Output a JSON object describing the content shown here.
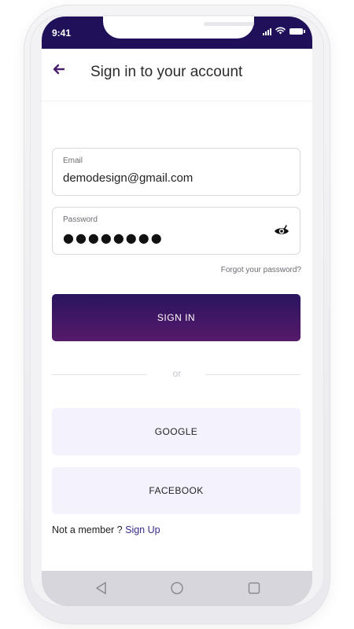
{
  "status_bar": {
    "time": "9:41",
    "icons": [
      "signal-icon",
      "wifi-icon",
      "battery-icon"
    ]
  },
  "header": {
    "back_icon": "arrow-left-icon",
    "title": "Sign in to your account"
  },
  "form": {
    "email": {
      "label": "Email",
      "value": "demodesign@gmail.com"
    },
    "password": {
      "label": "Password",
      "masked_value": "●●●●●●●●",
      "toggle_icon": "eye-icon"
    },
    "forgot_link": "Forgot your password?",
    "signin_label": "SIGN IN"
  },
  "divider": {
    "text": "or"
  },
  "social": {
    "google_label": "GOOGLE",
    "facebook_label": "FACEBOOK"
  },
  "footer": {
    "prompt": "Not a member ?",
    "signup_label": "Sign Up"
  },
  "nav": {
    "back_icon": "triangle-back-icon",
    "home_icon": "circle-home-icon",
    "recents_icon": "square-recents-icon"
  },
  "colors": {
    "status_bar": "#1f1059",
    "accent": "#4a1f6e",
    "button_gradient_start": "#2a145e",
    "button_gradient_end": "#561a6a",
    "social_button_bg": "#f4f2fd",
    "link": "#3a2a8c",
    "nav_bar": "#d6d6dc"
  }
}
